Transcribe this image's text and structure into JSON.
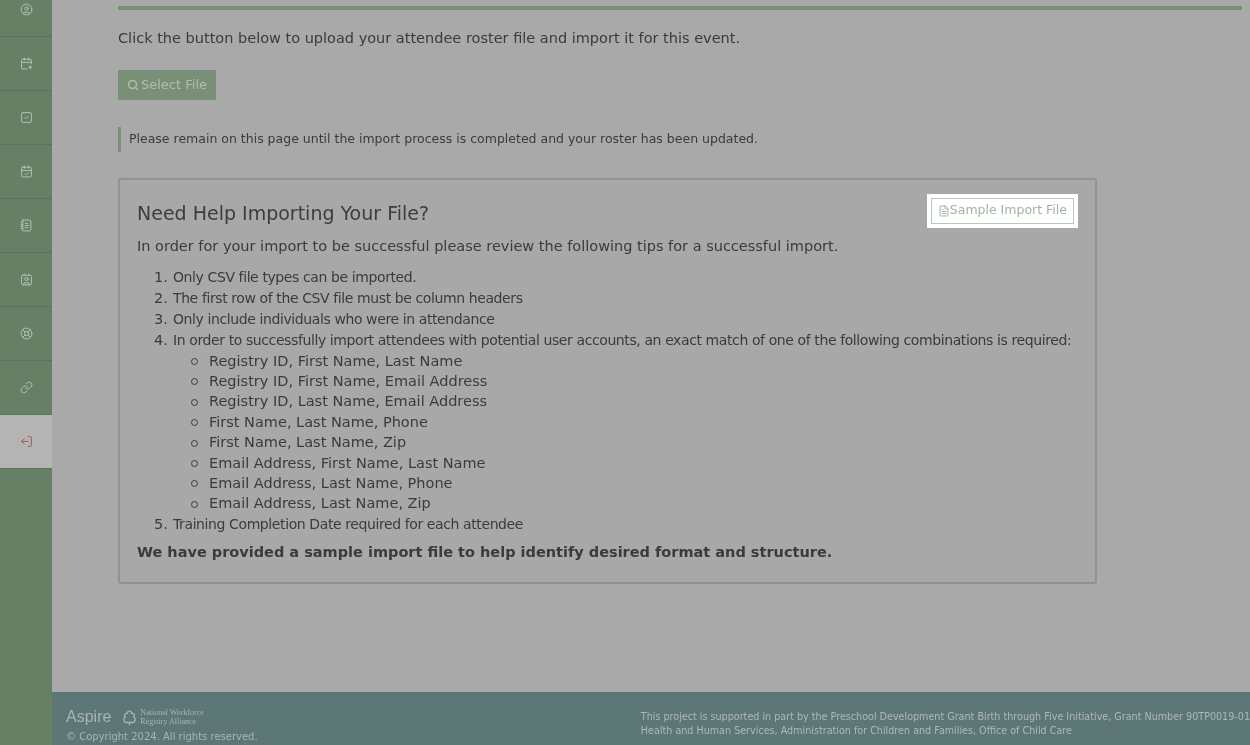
{
  "sidebar": {
    "items": [
      {
        "selected": false
      },
      {
        "selected": false
      },
      {
        "selected": false
      },
      {
        "selected": false
      },
      {
        "selected": false
      },
      {
        "selected": false
      },
      {
        "selected": false
      },
      {
        "selected": false
      },
      {
        "selected": true
      }
    ]
  },
  "intro": "Click the button below to upload your attendee roster file and import it for this event.",
  "select_button": {
    "label": "Select File"
  },
  "notice": "Please remain on this page until the import process is completed and your roster has been updated.",
  "help": {
    "title": "Need Help Importing Your File?",
    "sample_button": {
      "label": "Sample Import File",
      "highlighted": true
    },
    "intro": "In order for your import to be successful please review the following tips for a successful import.",
    "steps": [
      {
        "number": "1.",
        "text": "Only CSV file types can be imported."
      },
      {
        "number": "2.",
        "text": "The first row of the CSV file must be column headers"
      },
      {
        "number": "3.",
        "text": "Only include individuals who were in attendance"
      },
      {
        "number": "4.",
        "text": "In order to successfully import attendees with potential user accounts, an exact match of one of the following combinations is required:",
        "children": [
          "Registry ID, First Name, Last Name",
          "Registry ID, First Name, Email Address",
          "Registry ID, Last Name, Email Address",
          "First Name, Last Name, Phone",
          "First Name, Last Name, Zip",
          "Email Address, First Name, Last Name",
          "Email Address, Last Name, Phone",
          "Email Address, Last Name, Zip"
        ]
      },
      {
        "number": "5.",
        "text": "Training Completion Date required for each attendee"
      }
    ],
    "closing": "We have provided a sample import file to help identify desired format and structure."
  },
  "footer": {
    "logo": "Aspire",
    "partner_logo": "National Workforce Registry Alliance",
    "copyright": "© Copyright 2024. All rights reserved.",
    "funding": [
      "This project is supported in part by the Preschool Development Grant Birth through Five Initiative, Grant Number 90TP0019-01",
      "Health and Human Services, Administration for Children and Families, Office of Child Care"
    ]
  }
}
